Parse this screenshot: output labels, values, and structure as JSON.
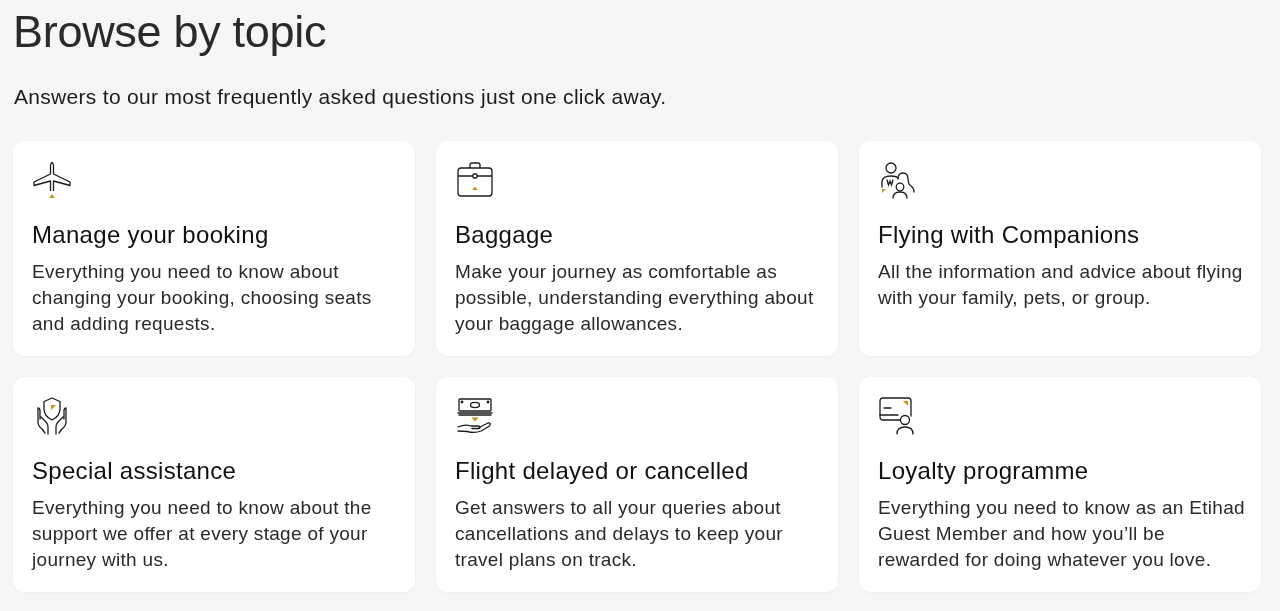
{
  "header": {
    "title": "Browse by topic",
    "subtitle": "Answers to our most frequently asked questions just one click away."
  },
  "topics": [
    {
      "title": "Manage your booking",
      "description": "Everything you need to know about changing your booking, choosing seats and adding requests."
    },
    {
      "title": "Baggage",
      "description": "Make your journey as comfortable as possible, understanding everything about your baggage allowances."
    },
    {
      "title": "Flying with Companions",
      "description": "All the information and advice about flying with your family, pets, or group."
    },
    {
      "title": "Special assistance",
      "description": "Everything you need to know about the support we offer at every stage of your journey with us."
    },
    {
      "title": "Flight delayed or cancelled",
      "description": "Get answers to all your queries about cancellations and delays to keep your travel plans on track."
    },
    {
      "title": "Loyalty programme",
      "description": "Everything you need to know as an Etihad Guest Member and how you’ll be rewarded for doing whatever you love."
    }
  ]
}
